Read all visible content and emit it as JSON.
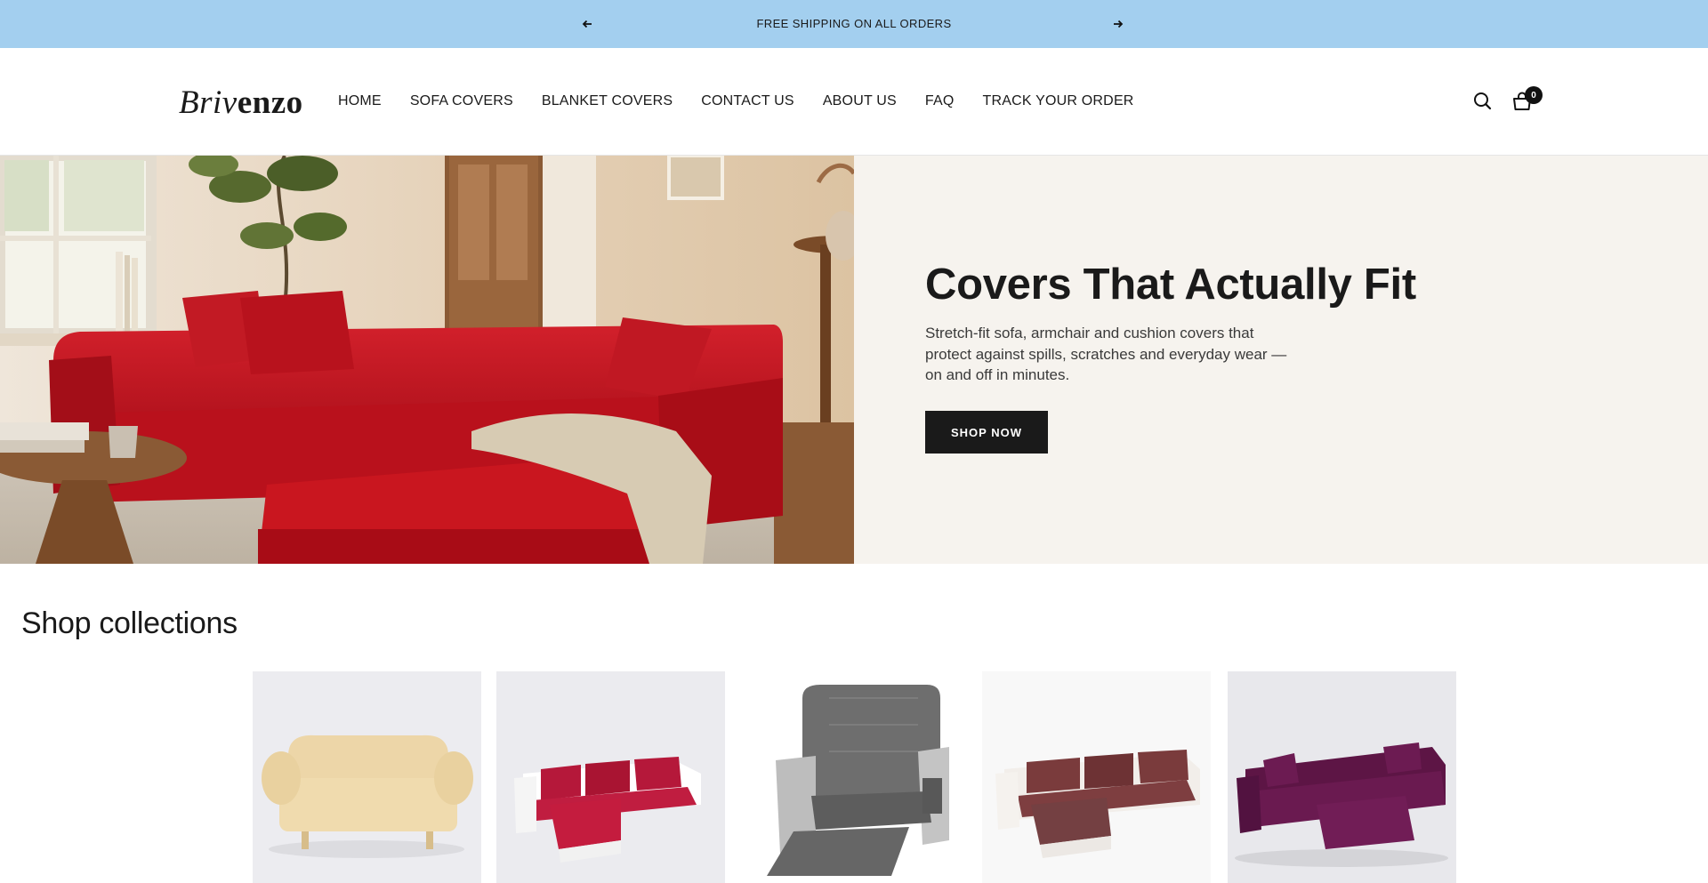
{
  "announcement": {
    "message": "FREE SHIPPING ON ALL ORDERS",
    "prev_icon": "arrow-left-icon",
    "next_icon": "arrow-right-icon"
  },
  "header": {
    "logo_part1": "Briv",
    "logo_part2": "enzo",
    "nav": [
      {
        "label": "HOME"
      },
      {
        "label": "SOFA COVERS"
      },
      {
        "label": "BLANKET COVERS"
      },
      {
        "label": "CONTACT US"
      },
      {
        "label": "ABOUT US"
      },
      {
        "label": "FAQ"
      },
      {
        "label": "TRACK YOUR ORDER"
      }
    ],
    "search_icon": "search-icon",
    "cart_icon": "cart-icon",
    "cart_count": "0"
  },
  "hero": {
    "title": "Covers That Actually Fit",
    "subtitle": "Stretch-fit sofa, armchair and cushion covers that protect against spills, scratches and everyday wear — on and off in minutes.",
    "button_label": "SHOP NOW"
  },
  "collections": {
    "title": "Shop collections"
  },
  "colors": {
    "announcement_bg": "#a3cfef",
    "hero_text_bg": "#f6f3ee",
    "button_bg": "#1a1a1a",
    "sofa_red": "#c4141f"
  }
}
